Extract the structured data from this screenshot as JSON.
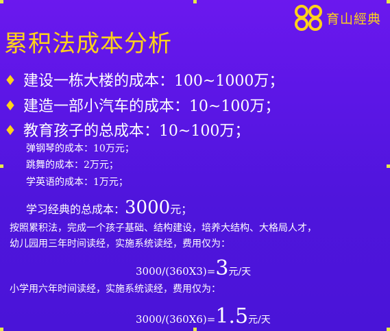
{
  "logo": {
    "text": "育山經典"
  },
  "title": "累积法成本分析",
  "bullets": [
    {
      "icon": "diamond-bullet-icon",
      "text": "建设一栋大楼的成本：100~1000万；"
    },
    {
      "icon": "diamond-bullet-icon",
      "text": "建造一部小汽车的成本：10~100万；"
    },
    {
      "icon": "diamond-bullet-icon",
      "text": "教育孩子的总成本：10~100万；"
    }
  ],
  "sub_items": [
    "弹钢琴的成本：10万元；",
    "跳舞的成本：2万元；",
    "学英语的成本：1万元；"
  ],
  "total": {
    "prefix": "学习经典的总成本：",
    "value": "3000",
    "suffix": "元；"
  },
  "paragraph1": [
    "按照累积法，完成一个孩子基础、结构建设，培养大结构、大格局人才，",
    "幼儿园用三年时间读经，实施系统读经，费用仅为："
  ],
  "formula1": {
    "expr": "3000/(360X3)=",
    "value": "3",
    "unit": "元/天"
  },
  "paragraph2": "小学用六年时间读经，实施系统读经，费用仅为：",
  "formula2": {
    "expr": "3000/(360X6)=",
    "value": "1.5",
    "unit": "元/天"
  }
}
